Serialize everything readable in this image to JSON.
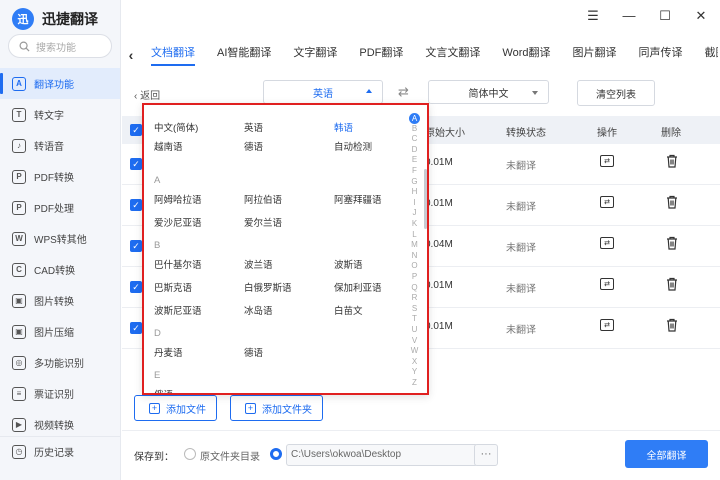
{
  "app": {
    "name": "迅捷翻译",
    "logo_glyph": "迅"
  },
  "window_controls": [
    "☰",
    "—",
    "☐",
    "✕"
  ],
  "sidebar": {
    "search_placeholder": "搜索功能",
    "items": [
      {
        "label": "翻译功能",
        "icon": "A",
        "active": true
      },
      {
        "label": "转文字",
        "icon": "T"
      },
      {
        "label": "转语音",
        "icon": "♪"
      },
      {
        "label": "PDF转换",
        "icon": "P"
      },
      {
        "label": "PDF处理",
        "icon": "P"
      },
      {
        "label": "WPS转其他",
        "icon": "W"
      },
      {
        "label": "CAD转换",
        "icon": "C"
      },
      {
        "label": "图片转换",
        "icon": "▣"
      },
      {
        "label": "图片压缩",
        "icon": "▣"
      },
      {
        "label": "多功能识别",
        "icon": "◎"
      },
      {
        "label": "票证识别",
        "icon": "≡"
      },
      {
        "label": "视频转换",
        "icon": "▶"
      }
    ],
    "bottom": "历史记录"
  },
  "tabs": [
    "文档翻译",
    "AI智能翻译",
    "文字翻译",
    "PDF翻译",
    "文言文翻译",
    "Word翻译",
    "图片翻译",
    "同声传译",
    "截图翻译"
  ],
  "toolbar": {
    "back": "返回",
    "source_lang": "英语",
    "swap_glyph": "⇄",
    "target_lang": "简体中文",
    "clear": "清空列表"
  },
  "table": {
    "headers": {
      "size": "原始大小",
      "status": "转换状态",
      "op": "操作",
      "del": "删除"
    },
    "rows": [
      {
        "size": "0.01M",
        "status": "未翻译"
      },
      {
        "size": "0.01M",
        "status": "未翻译"
      },
      {
        "size": "0.04M",
        "status": "未翻译"
      },
      {
        "size": "0.01M",
        "status": "未翻译"
      },
      {
        "size": "0.01M",
        "status": "未翻译"
      }
    ]
  },
  "buttons": {
    "add_file": "添加文件",
    "add_folder": "添加文件夹",
    "translate_all": "全部翻译"
  },
  "footer": {
    "save_to": "保存到：",
    "option_original": "原文件夹目录",
    "path": "C:\\Users\\okwoa\\Desktop",
    "more": "···"
  },
  "dropdown": {
    "top_rows": [
      [
        "中文(简体)",
        "英语",
        "韩语"
      ],
      [
        "越南语",
        "德语",
        "自动检测"
      ]
    ],
    "selected": "韩语",
    "groups": [
      {
        "letter": "A",
        "rows": [
          [
            "阿姆哈拉语",
            "阿拉伯语",
            "阿塞拜疆语"
          ],
          [
            "爱沙尼亚语",
            "爱尔兰语"
          ]
        ]
      },
      {
        "letter": "B",
        "rows": [
          [
            "巴什基尔语",
            "波兰语",
            "波斯语"
          ],
          [
            "巴斯克语",
            "白俄罗斯语",
            "保加利亚语"
          ],
          [
            "波斯尼亚语",
            "冰岛语",
            "白苗文"
          ]
        ]
      },
      {
        "letter": "D",
        "rows": [
          [
            "丹麦语",
            "德语"
          ]
        ]
      },
      {
        "letter": "E",
        "rows": [
          [
            "俄语"
          ]
        ]
      }
    ],
    "alphabet": [
      "A",
      "B",
      "C",
      "D",
      "E",
      "F",
      "G",
      "H",
      "I",
      "J",
      "K",
      "L",
      "M",
      "N",
      "O",
      "P",
      "Q",
      "R",
      "S",
      "T",
      "U",
      "V",
      "W",
      "X",
      "Y",
      "Z"
    ],
    "active_letter": "A"
  }
}
